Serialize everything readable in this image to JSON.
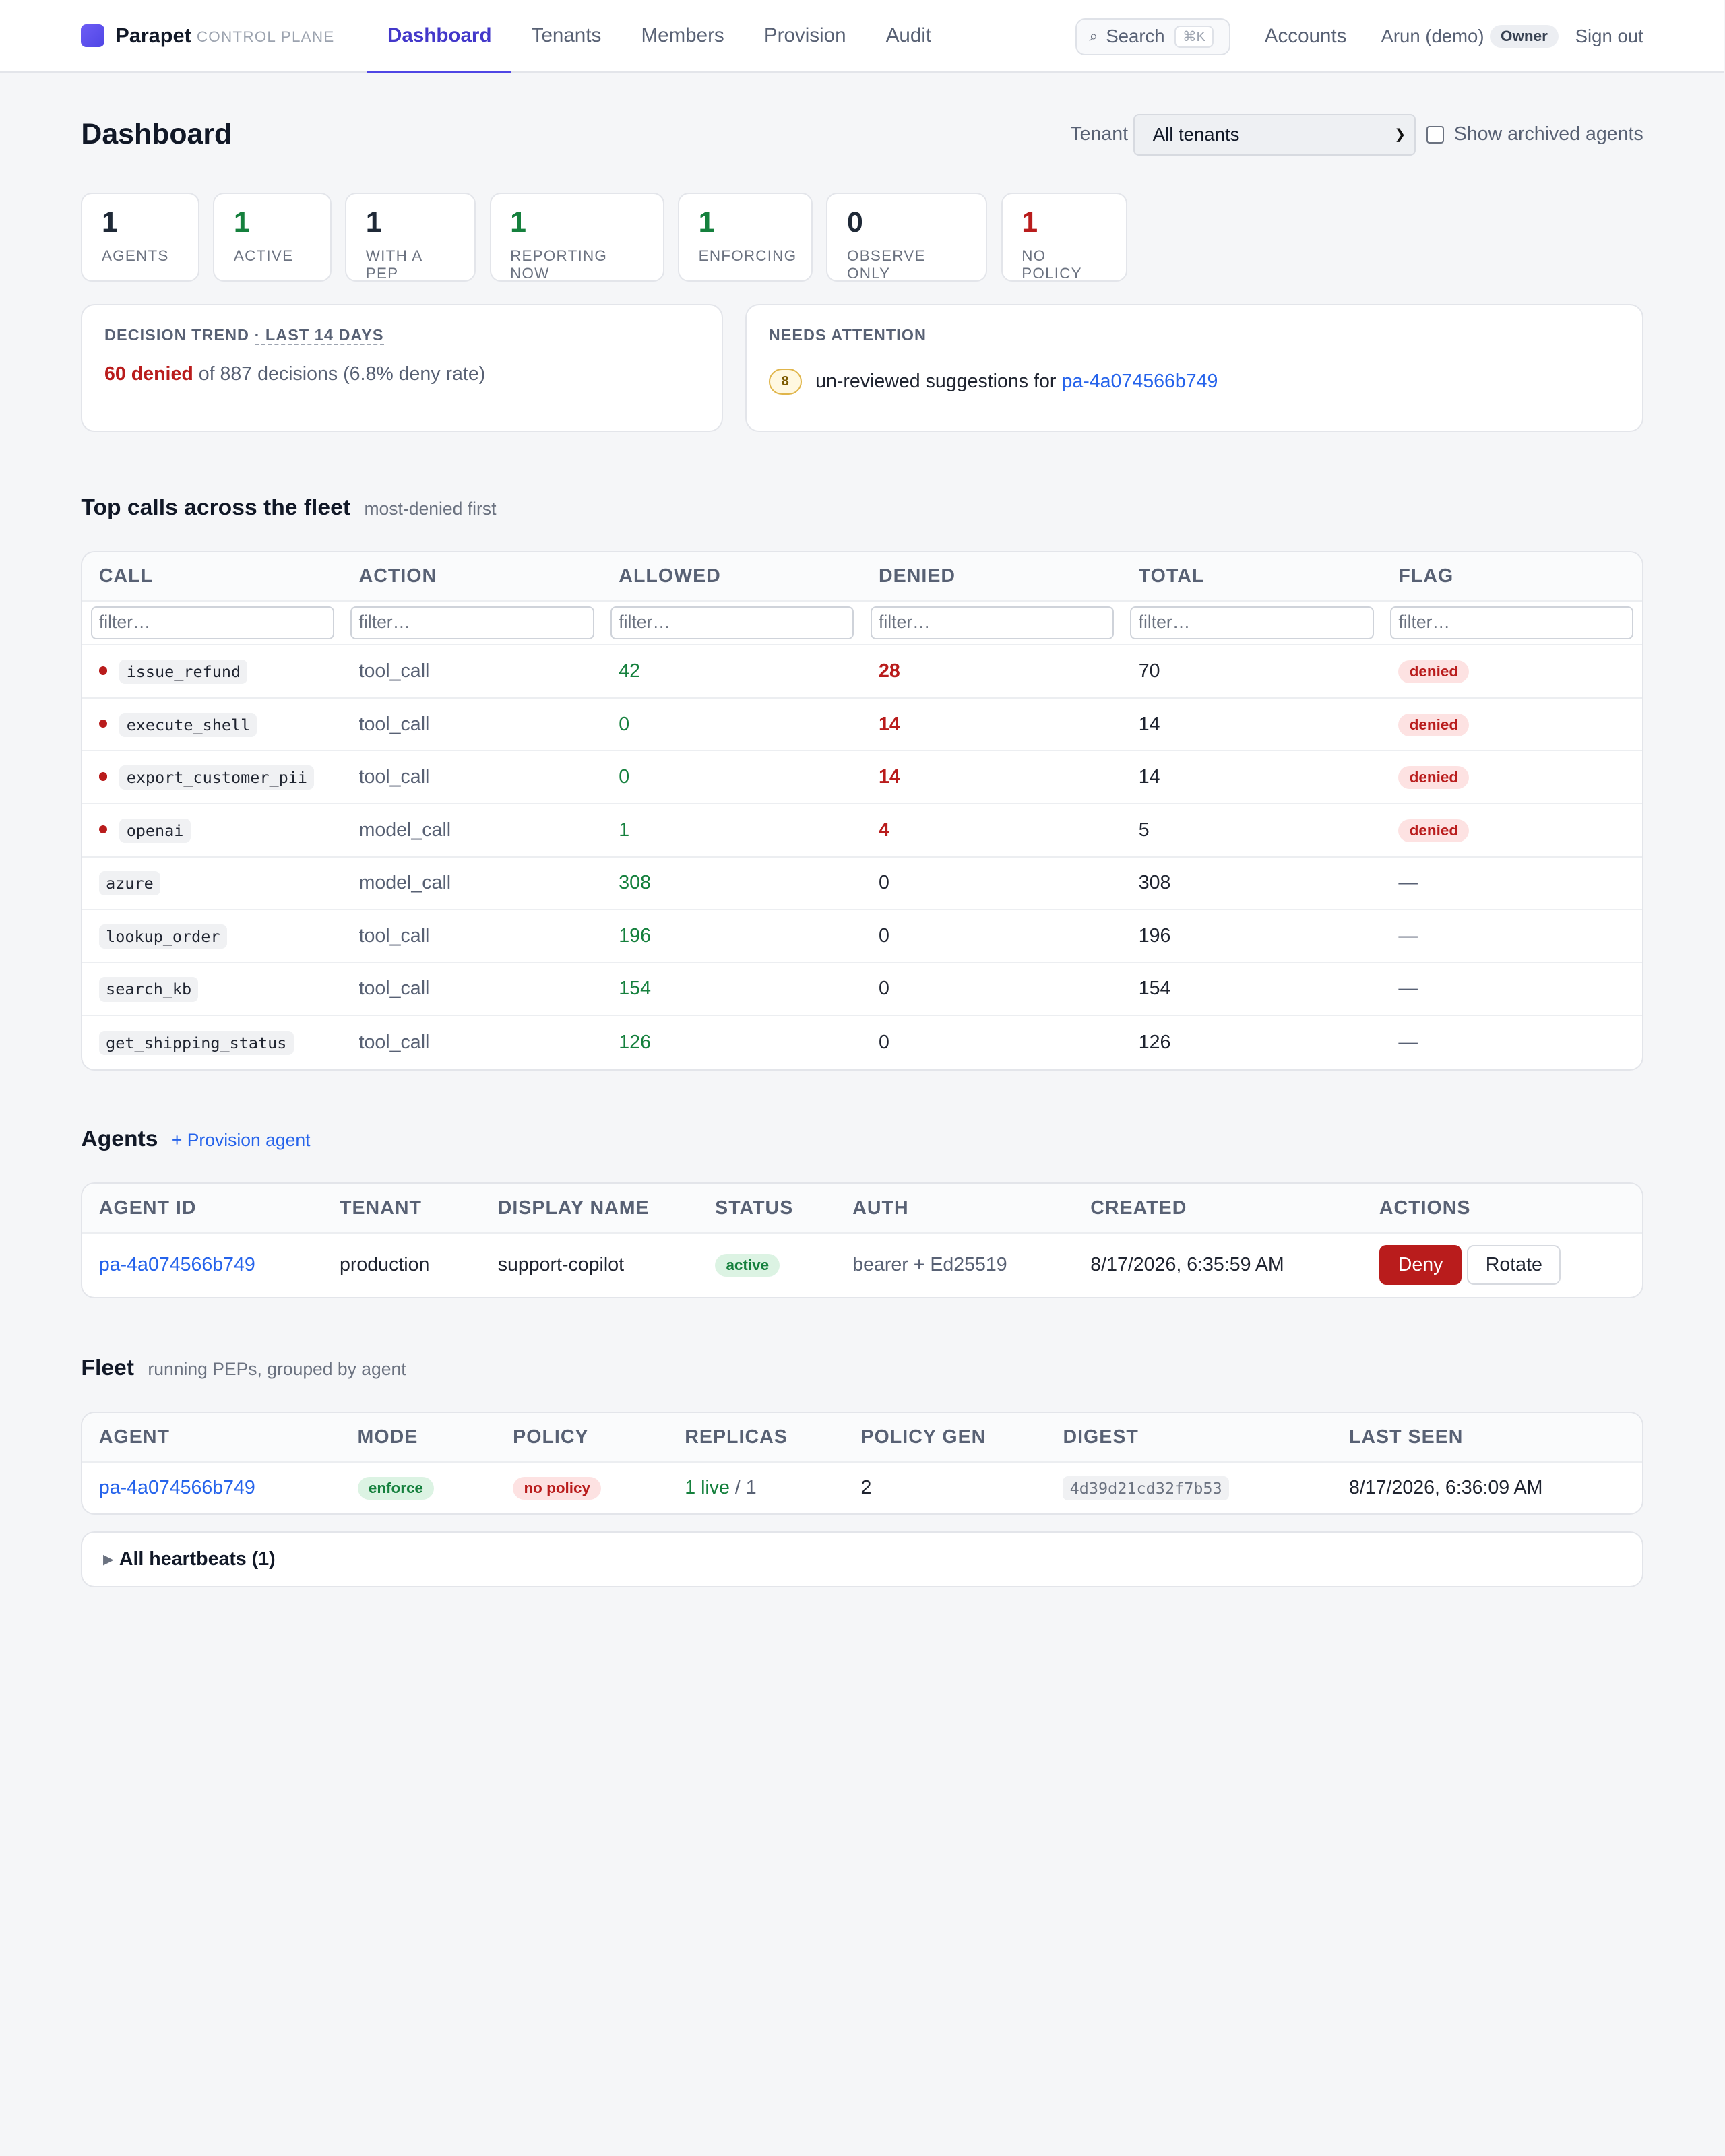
{
  "brand": {
    "name": "Parapet",
    "subtitle": "CONTROL PLANE"
  },
  "nav": {
    "tabs": [
      "Dashboard",
      "Tenants",
      "Members",
      "Provision",
      "Audit"
    ],
    "active": "Dashboard",
    "search_label": "Search",
    "search_shortcut": "⌘K",
    "accounts": "Accounts",
    "user": "Arun (demo)",
    "role": "Owner",
    "sign_out": "Sign out"
  },
  "header": {
    "title": "Dashboard",
    "tenant_label": "Tenant",
    "tenant_value": "All tenants",
    "archived_label": "Show archived agents"
  },
  "stats": [
    {
      "value": "1",
      "label": "AGENTS",
      "color": "#1f2937"
    },
    {
      "value": "1",
      "label": "ACTIVE",
      "color": "#15803d"
    },
    {
      "value": "1",
      "label": "WITH A PEP",
      "color": "#1f2937"
    },
    {
      "value": "1",
      "label": "REPORTING NOW",
      "color": "#15803d"
    },
    {
      "value": "1",
      "label": "ENFORCING",
      "color": "#15803d"
    },
    {
      "value": "0",
      "label": "OBSERVE ONLY",
      "color": "#1f2937"
    },
    {
      "value": "1",
      "label": "NO POLICY",
      "color": "#b91c1c"
    }
  ],
  "trend": {
    "title": "DECISION TREND",
    "window": "· LAST 14 DAYS",
    "denied": "60 denied",
    "rest": " of 887 decisions (6.8% deny rate)"
  },
  "attention": {
    "title": "NEEDS ATTENTION",
    "count": "8",
    "text": "un-reviewed suggestions for ",
    "agent": "pa-4a074566b749"
  },
  "top_calls": {
    "title": "Top calls across the fleet",
    "subtitle": "most-denied first",
    "columns": [
      "CALL",
      "ACTION",
      "ALLOWED",
      "DENIED",
      "TOTAL",
      "FLAG"
    ],
    "filter_placeholder": "filter…",
    "rows": [
      {
        "call": "issue_refund",
        "action": "tool_call",
        "allowed": "42",
        "denied": "28",
        "total": "70",
        "flag": "denied"
      },
      {
        "call": "execute_shell",
        "action": "tool_call",
        "allowed": "0",
        "denied": "14",
        "total": "14",
        "flag": "denied"
      },
      {
        "call": "export_customer_pii",
        "action": "tool_call",
        "allowed": "0",
        "denied": "14",
        "total": "14",
        "flag": "denied"
      },
      {
        "call": "openai",
        "action": "model_call",
        "allowed": "1",
        "denied": "4",
        "total": "5",
        "flag": "denied"
      },
      {
        "call": "azure",
        "action": "model_call",
        "allowed": "308",
        "denied": "0",
        "total": "308",
        "flag": "—"
      },
      {
        "call": "lookup_order",
        "action": "tool_call",
        "allowed": "196",
        "denied": "0",
        "total": "196",
        "flag": "—"
      },
      {
        "call": "search_kb",
        "action": "tool_call",
        "allowed": "154",
        "denied": "0",
        "total": "154",
        "flag": "—"
      },
      {
        "call": "get_shipping_status",
        "action": "tool_call",
        "allowed": "126",
        "denied": "0",
        "total": "126",
        "flag": "—"
      }
    ]
  },
  "agents": {
    "title": "Agents",
    "provision_link": "+ Provision agent",
    "columns": [
      "AGENT ID",
      "TENANT",
      "DISPLAY NAME",
      "STATUS",
      "AUTH",
      "CREATED",
      "ACTIONS"
    ],
    "row": {
      "agent_id": "pa-4a074566b749",
      "tenant": "production",
      "display_name": "support-copilot",
      "status": "active",
      "auth": "bearer + Ed25519",
      "created": "8/17/2026, 6:35:59 AM",
      "deny_label": "Deny",
      "rotate_label": "Rotate"
    }
  },
  "fleet": {
    "title": "Fleet",
    "subtitle": "running PEPs, grouped by agent",
    "columns": [
      "AGENT",
      "MODE",
      "POLICY",
      "REPLICAS",
      "POLICY GEN",
      "DIGEST",
      "LAST SEEN"
    ],
    "row": {
      "agent": "pa-4a074566b749",
      "mode": "enforce",
      "policy": "no policy",
      "replicas_live": "1 live",
      "replicas_total": " / 1",
      "policy_gen": "2",
      "digest": "4d39d21cd32f7b53",
      "last_seen": "8/17/2026, 6:36:09 AM"
    },
    "heartbeats_label": "All heartbeats (1)"
  }
}
